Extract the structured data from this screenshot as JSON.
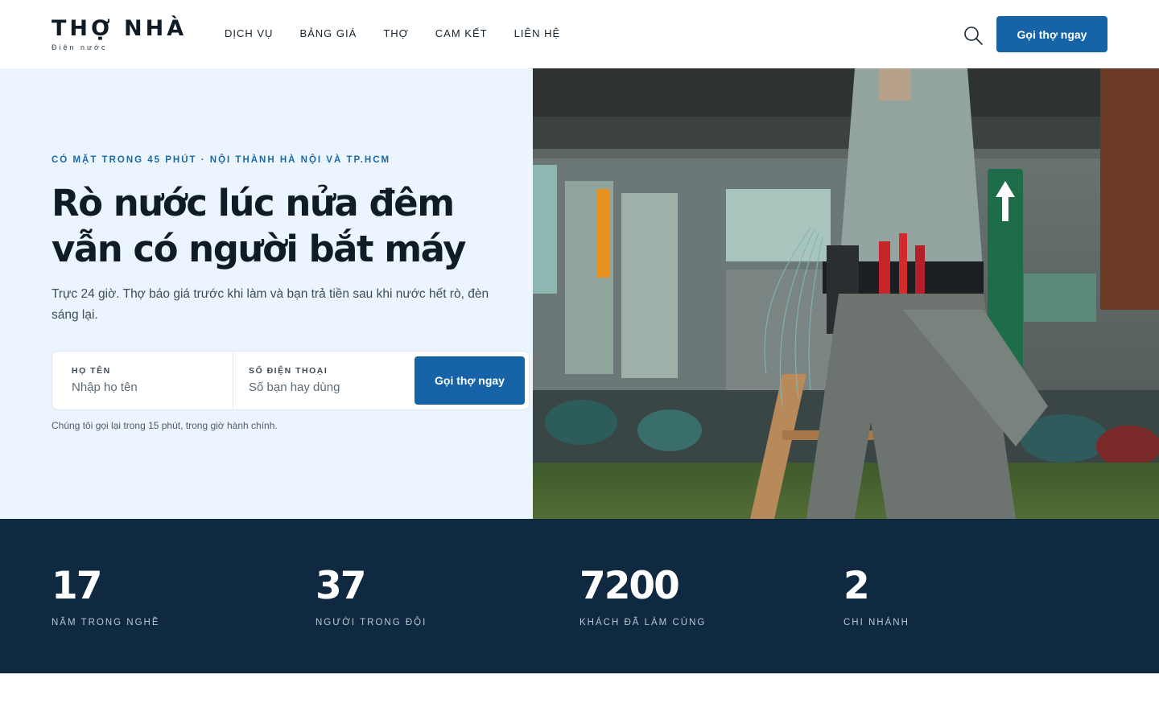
{
  "header": {
    "logo": {
      "title": "THỢ NHÀ",
      "subtitle": "Điện nước"
    },
    "nav": [
      "DỊCH VỤ",
      "BẢNG GIÁ",
      "THỢ",
      "CAM KẾT",
      "LIÊN HỆ"
    ],
    "search_icon": "search-icon",
    "cta_label": "Gọi thợ ngay"
  },
  "hero": {
    "eyebrow": "CÓ MẶT TRONG 45 PHÚT · NỘI THÀNH HÀ NỘI VÀ TP.HCM",
    "headline": "Rò nước lúc nửa đêm vẫn có người bắt máy",
    "lead": "Trực 24 giờ. Thợ báo giá trước khi làm và bạn trả tiền sau khi nước hết rò, đèn sáng lại.",
    "form": {
      "name_label": "HỌ TÊN",
      "name_placeholder": "Nhập họ tên",
      "phone_label": "SỐ ĐIỆN THOẠI",
      "phone_placeholder": "Số bạn hay dùng",
      "submit_label": "Gọi thợ ngay"
    },
    "note": "Chúng tôi gọi lại trong 15 phút, trong giờ hành chính."
  },
  "stats": [
    {
      "value": "17",
      "label": "NĂM TRONG NGHỀ"
    },
    {
      "value": "37",
      "label": "NGƯỜI TRONG ĐỘI"
    },
    {
      "value": "7200",
      "label": "KHÁCH ĐÃ LÀM CÙNG"
    },
    {
      "value": "2",
      "label": "CHI NHÁNH"
    }
  ],
  "colors": {
    "primary": "#1664a7",
    "hero_bg": "#ecf4fd",
    "stats_bg": "#0f2a40",
    "eyebrow": "#1a6aa8"
  }
}
